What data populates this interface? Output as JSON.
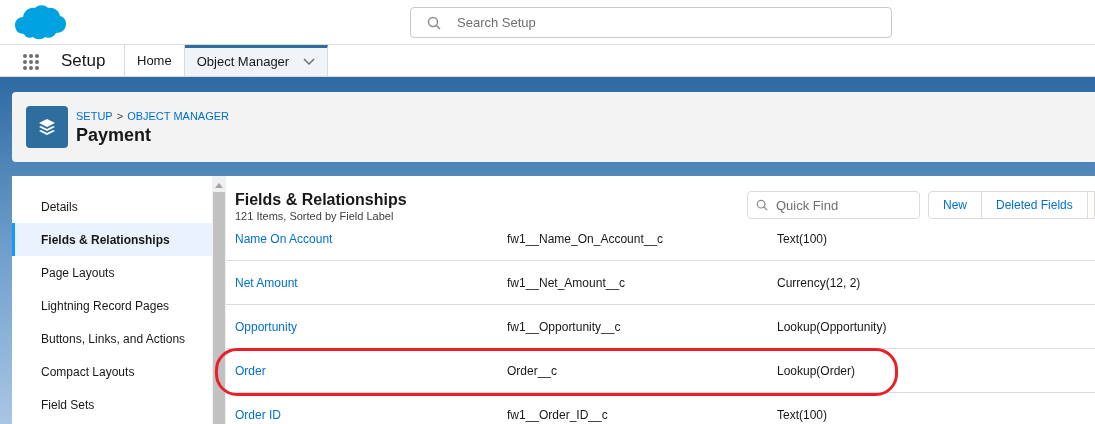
{
  "global_header": {
    "search": {
      "placeholder": "Search Setup"
    }
  },
  "nav": {
    "app_name": "Setup",
    "tabs": [
      {
        "label": "Home",
        "selected": false,
        "has_menu": false
      },
      {
        "label": "Object Manager",
        "selected": true,
        "has_menu": true
      }
    ]
  },
  "page_header": {
    "breadcrumb": [
      "SETUP",
      "OBJECT MANAGER"
    ],
    "breadcrumb_separator": ">",
    "title": "Payment"
  },
  "sidebar": {
    "items": [
      {
        "label": "Details",
        "selected": false
      },
      {
        "label": "Fields & Relationships",
        "selected": true
      },
      {
        "label": "Page Layouts",
        "selected": false
      },
      {
        "label": "Lightning Record Pages",
        "selected": false
      },
      {
        "label": "Buttons, Links, and Actions",
        "selected": false
      },
      {
        "label": "Compact Layouts",
        "selected": false
      },
      {
        "label": "Field Sets",
        "selected": false
      }
    ]
  },
  "main": {
    "title": "Fields & Relationships",
    "subtitle": "121 Items, Sorted by Field Label",
    "quick_find": {
      "placeholder": "Quick Find"
    },
    "buttons": [
      "New",
      "Deleted Fields"
    ],
    "rows": [
      {
        "label": "Name On Account",
        "api_name": "fw1__Name_On_Account__c",
        "data_type": "Text(100)",
        "highlighted": false
      },
      {
        "label": "Net Amount",
        "api_name": "fw1__Net_Amount__c",
        "data_type": "Currency(12, 2)",
        "highlighted": false
      },
      {
        "label": "Opportunity",
        "api_name": "fw1__Opportunity__c",
        "data_type": "Lookup(Opportunity)",
        "highlighted": false
      },
      {
        "label": "Order",
        "api_name": "Order__c",
        "data_type": "Lookup(Order)",
        "highlighted": true
      },
      {
        "label": "Order ID",
        "api_name": "fw1__Order_ID__c",
        "data_type": "Text(100)",
        "highlighted": false
      }
    ]
  }
}
